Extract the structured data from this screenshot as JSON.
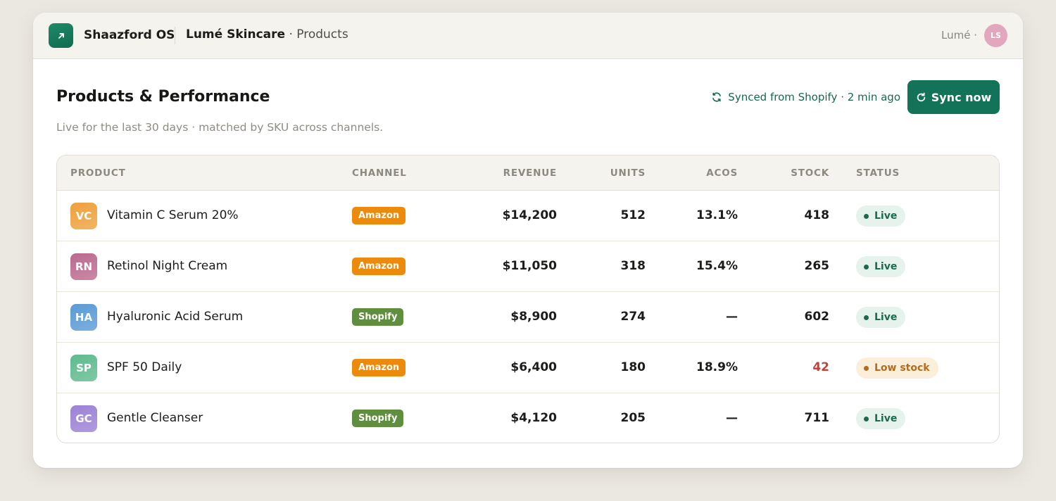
{
  "app": {
    "name": "Shaazford OS",
    "logo_icon": "arrow-up-right-icon",
    "accent": "#137358"
  },
  "breadcrumb": {
    "brand": "Lumé Skincare",
    "separator": " · ",
    "page": "Products"
  },
  "user": {
    "name": "Lumé ·",
    "initials": "LS",
    "avatar_color": "#e2a6bd"
  },
  "header": {
    "title": "Products & Performance",
    "subtitle": "Live for the last 30 days · matched by SKU across channels.",
    "sync_status": "Synced from Shopify · 2 min ago",
    "sync_button": "Sync now"
  },
  "table": {
    "columns": {
      "product": "PRODUCT",
      "channel": "CHANNEL",
      "revenue": "REVENUE",
      "units": "UNITS",
      "acos": "ACOS",
      "stock": "STOCK",
      "status": "STATUS"
    },
    "rows": [
      {
        "initials": "VC",
        "thumb_color": "#eea13d",
        "name": "Vitamin C Serum 20%",
        "channel": "Amazon",
        "channel_color": "#ec8a0c",
        "revenue": "$14,200",
        "units": "512",
        "acos": "13.1%",
        "stock": "418",
        "stock_color": "#1c1c1a",
        "status": "Live",
        "status_kind": "live"
      },
      {
        "initials": "RN",
        "thumb_color": "#bc6a8f",
        "name": "Retinol Night Cream",
        "channel": "Amazon",
        "channel_color": "#ec8a0c",
        "revenue": "$11,050",
        "units": "318",
        "acos": "15.4%",
        "stock": "265",
        "stock_color": "#1c1c1a",
        "status": "Live",
        "status_kind": "live"
      },
      {
        "initials": "HA",
        "thumb_color": "#5b9bd6",
        "name": "Hyaluronic Acid Serum",
        "channel": "Shopify",
        "channel_color": "#5f8e3e",
        "revenue": "$8,900",
        "units": "274",
        "acos": "—",
        "stock": "602",
        "stock_color": "#1c1c1a",
        "status": "Live",
        "status_kind": "live"
      },
      {
        "initials": "SP",
        "thumb_color": "#5fbb8e",
        "name": "SPF 50 Daily",
        "channel": "Amazon",
        "channel_color": "#ec8a0c",
        "revenue": "$6,400",
        "units": "180",
        "acos": "18.9%",
        "stock": "42",
        "stock_color": "#c0433a",
        "status": "Low stock",
        "status_kind": "low"
      },
      {
        "initials": "GC",
        "thumb_color": "#9c82d4",
        "name": "Gentle Cleanser",
        "channel": "Shopify",
        "channel_color": "#5f8e3e",
        "revenue": "$4,120",
        "units": "205",
        "acos": "—",
        "stock": "711",
        "stock_color": "#1c1c1a",
        "status": "Live",
        "status_kind": "live"
      }
    ]
  }
}
